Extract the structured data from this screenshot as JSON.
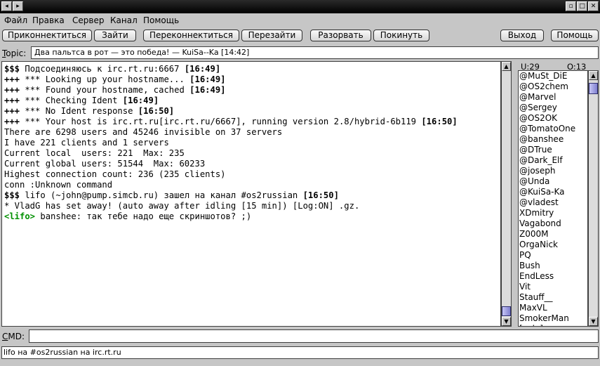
{
  "titlebar": {
    "left_buttons": [
      "◂",
      "▸"
    ],
    "right_buttons": [
      "▫",
      "□",
      "✕"
    ]
  },
  "menu": [
    "Файл",
    "Правка",
    "Сервер",
    "Канал",
    "Помощь"
  ],
  "toolbar": {
    "connect": "Приконнектиться",
    "join": "Зайти",
    "reconnect": "Переконнектиться",
    "rejoin": "Перезайти",
    "disconnect": "Разорвать",
    "leave": "Покинуть",
    "exit": "Выход",
    "help": "Помощь"
  },
  "topic": {
    "label_first": "T",
    "label_rest": "opic:",
    "text": "Два пальтса в рот — это победа! — KuiSa--Ka [14:42]"
  },
  "chat": [
    {
      "prefix": "$$$",
      "text": " Подсоединяюсь к irc.rt.ru:6667 ",
      "time": "[16:49]"
    },
    {
      "prefix": "+++",
      "text": " *** Looking up your hostname... ",
      "time": "[16:49]"
    },
    {
      "prefix": "+++",
      "text": " *** Found your hostname, cached ",
      "time": "[16:49]"
    },
    {
      "prefix": "+++",
      "text": " *** Checking Ident ",
      "time": "[16:49]"
    },
    {
      "prefix": "+++",
      "text": " *** No Ident response ",
      "time": "[16:50]"
    },
    {
      "prefix": "+++",
      "text": " *** Your host is irc.rt.ru[irc.rt.ru/6667], running version 2.8/hybrid-6b119 ",
      "time": "[16:50]"
    },
    {
      "prefix": "",
      "text": "There are 6298 users and 45246 invisible on 37 servers",
      "time": ""
    },
    {
      "prefix": "",
      "text": "I have 221 clients and 1 servers",
      "time": ""
    },
    {
      "prefix": "",
      "text": "Current local  users: 221  Max: 235",
      "time": ""
    },
    {
      "prefix": "",
      "text": "Current global users: 51544  Max: 60233",
      "time": ""
    },
    {
      "prefix": "",
      "text": "Highest connection count: 236 (235 clients)",
      "time": ""
    },
    {
      "prefix": "",
      "text": "conn :Unknown command",
      "time": ""
    },
    {
      "prefix": "$$$",
      "text": " lifo (~john@pump.simcb.ru) зашел на канал #os2russian ",
      "time": "[16:50]"
    },
    {
      "prefix": "",
      "text": "* VladG has set away! (auto away after idling [15 min]) [Log:ON] .gz.",
      "time": ""
    },
    {
      "prefix": "<lifo>",
      "text": " banshee: так тебе надо еще скриншотов? ;)",
      "time": "",
      "nick": true
    }
  ],
  "users_header": {
    "users": "U:29",
    "ops": "O:13"
  },
  "users": [
    "@MuSt_DiE",
    "@OS2chem",
    "@Marvel",
    "@Sergey",
    "@OS2OK",
    "@TomatoOne",
    "@banshee",
    "@DTrue",
    "@Dark_Elf",
    "@joseph",
    "@Unda",
    "@KuiSa-Ka",
    "@vladest",
    "XDmitry",
    "Vagabond",
    "Z000M",
    "OrgaNick",
    "PQ",
    "Bush",
    "EndLess",
    "Vit",
    "Stauff__",
    "MaxVL",
    "SmokerMan",
    "[eclo]"
  ],
  "cmd": {
    "label_first": "C",
    "label_rest": "MD:",
    "value": ""
  },
  "status": "lifo на #os2russian на irc.rt.ru",
  "colors": {
    "nick": "#009000",
    "scroll_thumb": "#8080d0"
  }
}
